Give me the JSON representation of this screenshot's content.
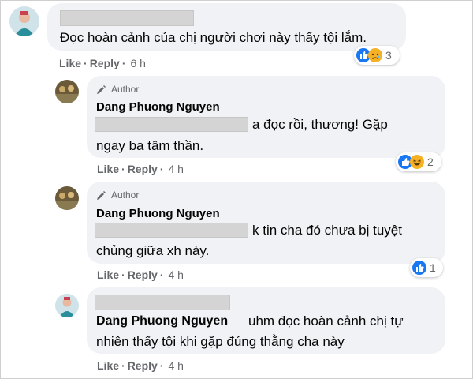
{
  "thread": {
    "comments": [
      {
        "text": "Đọc hoàn cảnh của chị người chơi này thấy tội lắm.",
        "actions": {
          "like": "Like",
          "reply": "Reply",
          "time": "6 h"
        },
        "reactions": {
          "icons": [
            "like",
            "sad"
          ],
          "count": "3"
        }
      },
      {
        "badge": "Author",
        "name": "Dang Phuong Nguyen",
        "line1": "a đọc rồi, thương! Gặp",
        "line2": "ngay ba tâm thần.",
        "actions": {
          "like": "Like",
          "reply": "Reply",
          "time": "4 h"
        },
        "reactions": {
          "icons": [
            "like",
            "haha"
          ],
          "count": "2"
        }
      },
      {
        "badge": "Author",
        "name": "Dang Phuong Nguyen",
        "line1": "k tin cha đó chưa bị tuyệt",
        "line2": "chủng giữa xh này.",
        "actions": {
          "like": "Like",
          "reply": "Reply",
          "time": "4 h"
        },
        "reactions": {
          "icons": [
            "like"
          ],
          "count": "1"
        }
      },
      {
        "mention": "Dang Phuong Nguyen",
        "line1": "uhm đọc hoàn cảnh chị tự",
        "line2": "nhiên thấy tội khi gặp đúng thằng cha này",
        "actions": {
          "like": "Like",
          "reply": "Reply",
          "time": "4 h"
        }
      }
    ]
  },
  "colors": {
    "bubble": "#f0f2f5",
    "meta_text": "#65676b",
    "like_blue": "#1877f2",
    "emoji_yellow": "#f7b125"
  }
}
